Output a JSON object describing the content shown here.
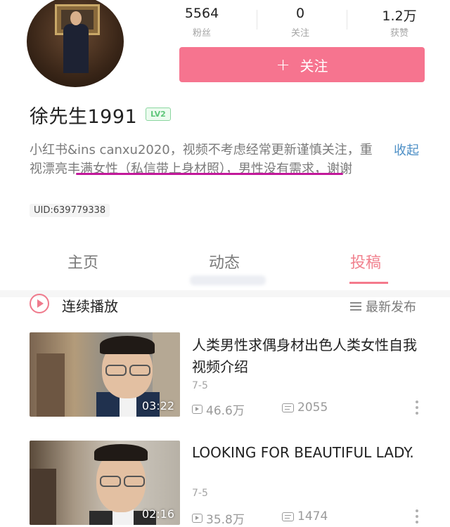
{
  "profile": {
    "stats": [
      {
        "value": "5564",
        "label": "粉丝"
      },
      {
        "value": "0",
        "label": "关注"
      },
      {
        "value": "1.2万",
        "label": "获赞"
      }
    ],
    "follow_button": {
      "icon": "plus-icon",
      "label": "关注",
      "color": "#f6748f"
    },
    "username": "徐先生1991",
    "level_badge": "LV2",
    "bio": "小红书&ins canxu2020，视频不考虑经常更新谨慎关注，重视漂亮丰满女性（私信带上身材照），男性没有需求，谢谢",
    "bio_toggle": "收起",
    "uid": "UID:639779338"
  },
  "tabs": [
    {
      "label": "主页",
      "active": false
    },
    {
      "label": "动态",
      "active": false
    },
    {
      "label": "投稿",
      "active": true
    }
  ],
  "playlist_bar": {
    "autoplay_label": "连续播放",
    "sort_label": "最新发布"
  },
  "videos": [
    {
      "title": "人类男性求偶身材出色人类女性自我视频介绍",
      "date": "7-5",
      "duration": "03:22",
      "plays": "46.6万",
      "comments": "2055"
    },
    {
      "title": "LOOKING FOR BEAUTIFUL LADY.",
      "date": "7-5",
      "duration": "02:16",
      "plays": "35.8万",
      "comments": "1474"
    }
  ],
  "colors": {
    "accent_pink": "#f6748f",
    "link_blue": "#4d8fc6",
    "annotation_underline": "#c2189a"
  }
}
